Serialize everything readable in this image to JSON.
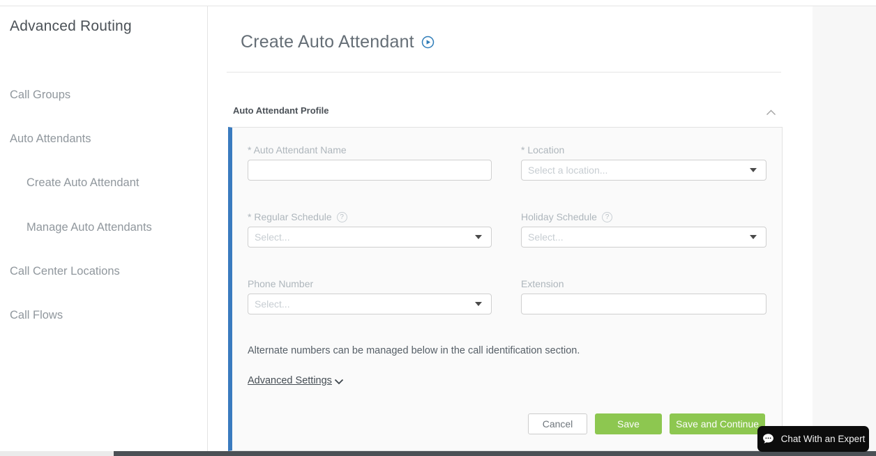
{
  "sidebar": {
    "title": "Advanced Routing",
    "items": [
      {
        "label": "Call Groups"
      },
      {
        "label": "Auto Attendants"
      },
      {
        "label": "Create Auto Attendant"
      },
      {
        "label": "Manage Auto Attendants"
      },
      {
        "label": "Call Center Locations"
      },
      {
        "label": "Call Flows"
      }
    ]
  },
  "main": {
    "title": "Create Auto Attendant",
    "profile_section": {
      "title": "Auto Attendant Profile",
      "fields": {
        "name": {
          "label": "* Auto Attendant Name",
          "value": ""
        },
        "location": {
          "label": "* Location",
          "placeholder": "Select a location..."
        },
        "regular_schedule": {
          "label": "* Regular Schedule",
          "help": "?",
          "placeholder": "Select..."
        },
        "holiday_schedule": {
          "label": "Holiday Schedule",
          "help": "?",
          "placeholder": "Select..."
        },
        "phone_number": {
          "label": "Phone Number",
          "placeholder": "Select..."
        },
        "extension": {
          "label": "Extension",
          "value": ""
        }
      },
      "note": "Alternate numbers can be managed below in the call identification section.",
      "advanced_settings_label": "Advanced Settings",
      "buttons": {
        "cancel": "Cancel",
        "save": "Save",
        "save_and_continue": "Save and Continue"
      }
    }
  },
  "chat": {
    "label": "Chat With an Expert"
  },
  "colors": {
    "accent_blue": "#3a7bbf",
    "play_icon_blue": "#2e7cb8",
    "action_green": "#8dc750",
    "chat_black": "#0c0c0c"
  }
}
